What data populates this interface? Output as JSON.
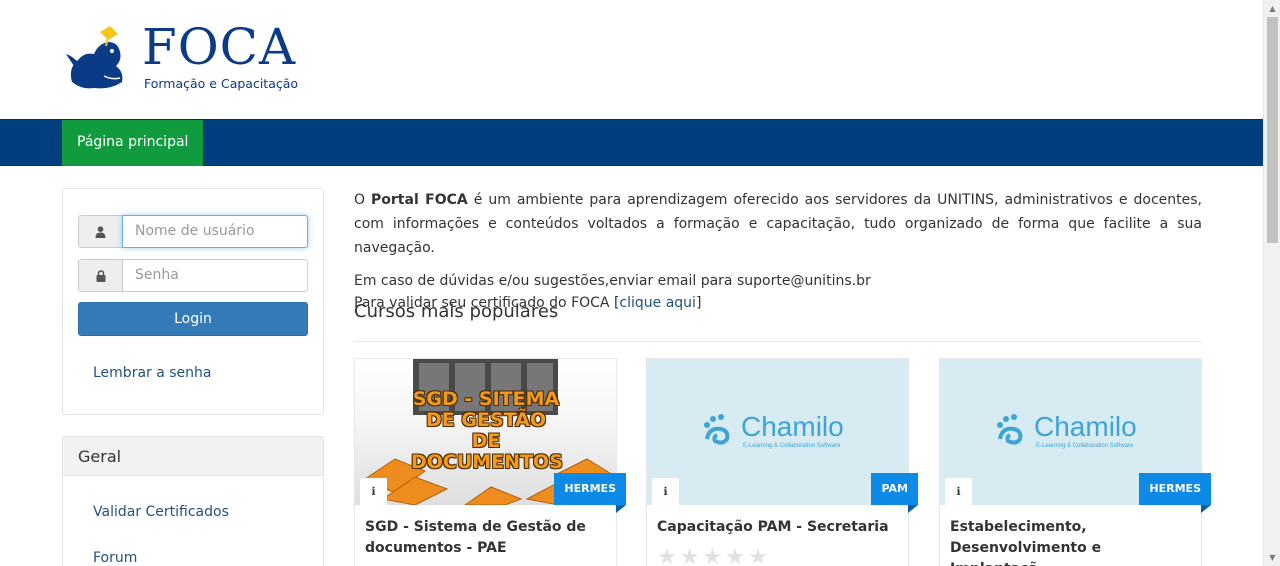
{
  "logo": {
    "title": "FOCA",
    "subtitle": "Formação e Capacitação"
  },
  "nav": {
    "active_label": "Página principal"
  },
  "login": {
    "username_placeholder": "Nome de usuário",
    "password_placeholder": "Senha",
    "button_label": "Login",
    "remember_label": "Lembrar a senha"
  },
  "sidebar": {
    "heading": "Geral",
    "items": [
      {
        "label": "Validar Certificados"
      },
      {
        "label": "Forum"
      }
    ]
  },
  "main": {
    "intro_prefix": "O ",
    "intro_bold": "Portal FOCA",
    "intro_rest": " é um ambiente para aprendizagem oferecido aos servidores da UNITINS, administrativos e docentes, com informações e conteúdos voltados a formação e capacitação, tudo organizado de forma que facilite a sua navegação.",
    "support_line": "Em caso de dúvidas e/ou sugestões,enviar email para suporte@unitins.br",
    "certificate_prefix": "Para validar seu certificado do FOCA [",
    "certificate_link": "clique aqui",
    "certificate_suffix": "]",
    "section_title": "Cursos mais populares"
  },
  "courses": [
    {
      "title": "SGD - Sistema de Gestão de documentos - PAE",
      "tag": "HERMES",
      "image_text": "SGD - SITEMA DE GESTÃO DE DOCUMENTOS"
    },
    {
      "title": "Capacitação PAM - Secretaria",
      "tag": "PAM",
      "image_logo": "Chamilo",
      "image_logo_sub": "E-Learning & Collaboration Software"
    },
    {
      "title": "Estabelecimento, Desenvolvimento e Implantaçã ...",
      "tag": "HERMES",
      "image_logo": "Chamilo",
      "image_logo_sub": "E-Learning & Collaboration Software"
    }
  ],
  "colors": {
    "navbar": "#003f7d",
    "nav_active": "#109b3e",
    "primary_button": "#337ab7",
    "tag": "#0d8ae6",
    "link": "#23527c"
  }
}
